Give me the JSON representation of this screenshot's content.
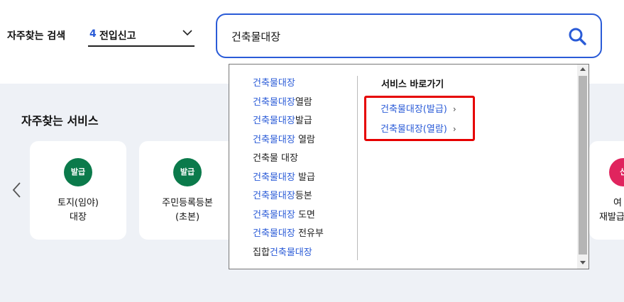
{
  "header": {
    "freq_search_label": "자주찾는 검색",
    "select_num": "4",
    "select_text": "전입신고",
    "search_value": "건축물대장"
  },
  "services": {
    "title": "자주찾는 서비스",
    "cards": [
      {
        "badge": "발급",
        "line1": "토지(임야)",
        "line2": "대장"
      },
      {
        "badge": "발급",
        "line1": "주민등록등본",
        "line2": "(초본)"
      },
      {
        "badge": "신",
        "line1": "여",
        "line2": "재발급 온"
      }
    ]
  },
  "dropdown": {
    "suggestions": [
      {
        "hl": "건축물대장",
        "rest": ""
      },
      {
        "hl": "건축물대장",
        "rest": "열람"
      },
      {
        "hl": "건축물대장",
        "rest": "발급"
      },
      {
        "hl": "건축물대장",
        "rest": " 열람"
      },
      {
        "hl": "",
        "rest": "건축물 대장"
      },
      {
        "hl": "건축물대장",
        "rest": " 발급"
      },
      {
        "hl": "건축물대장",
        "rest": "등본"
      },
      {
        "hl": "건축물대장",
        "rest": " 도면"
      },
      {
        "hl": "건축물대장",
        "rest": " 전유부"
      },
      {
        "pre": "집합",
        "hl": "건축물대장",
        "rest": ""
      }
    ],
    "service_go_title": "서비스 바로가기",
    "links": [
      {
        "label": "건축물대장(발급)",
        "arrow": "›"
      },
      {
        "label": "건축물대장(열람)",
        "arrow": "›"
      }
    ]
  },
  "colors": {
    "accent": "#2a5bd7",
    "badge_green": "#0b7a4b",
    "badge_pink": "#e0245e",
    "highlight_box": "#e60000"
  }
}
